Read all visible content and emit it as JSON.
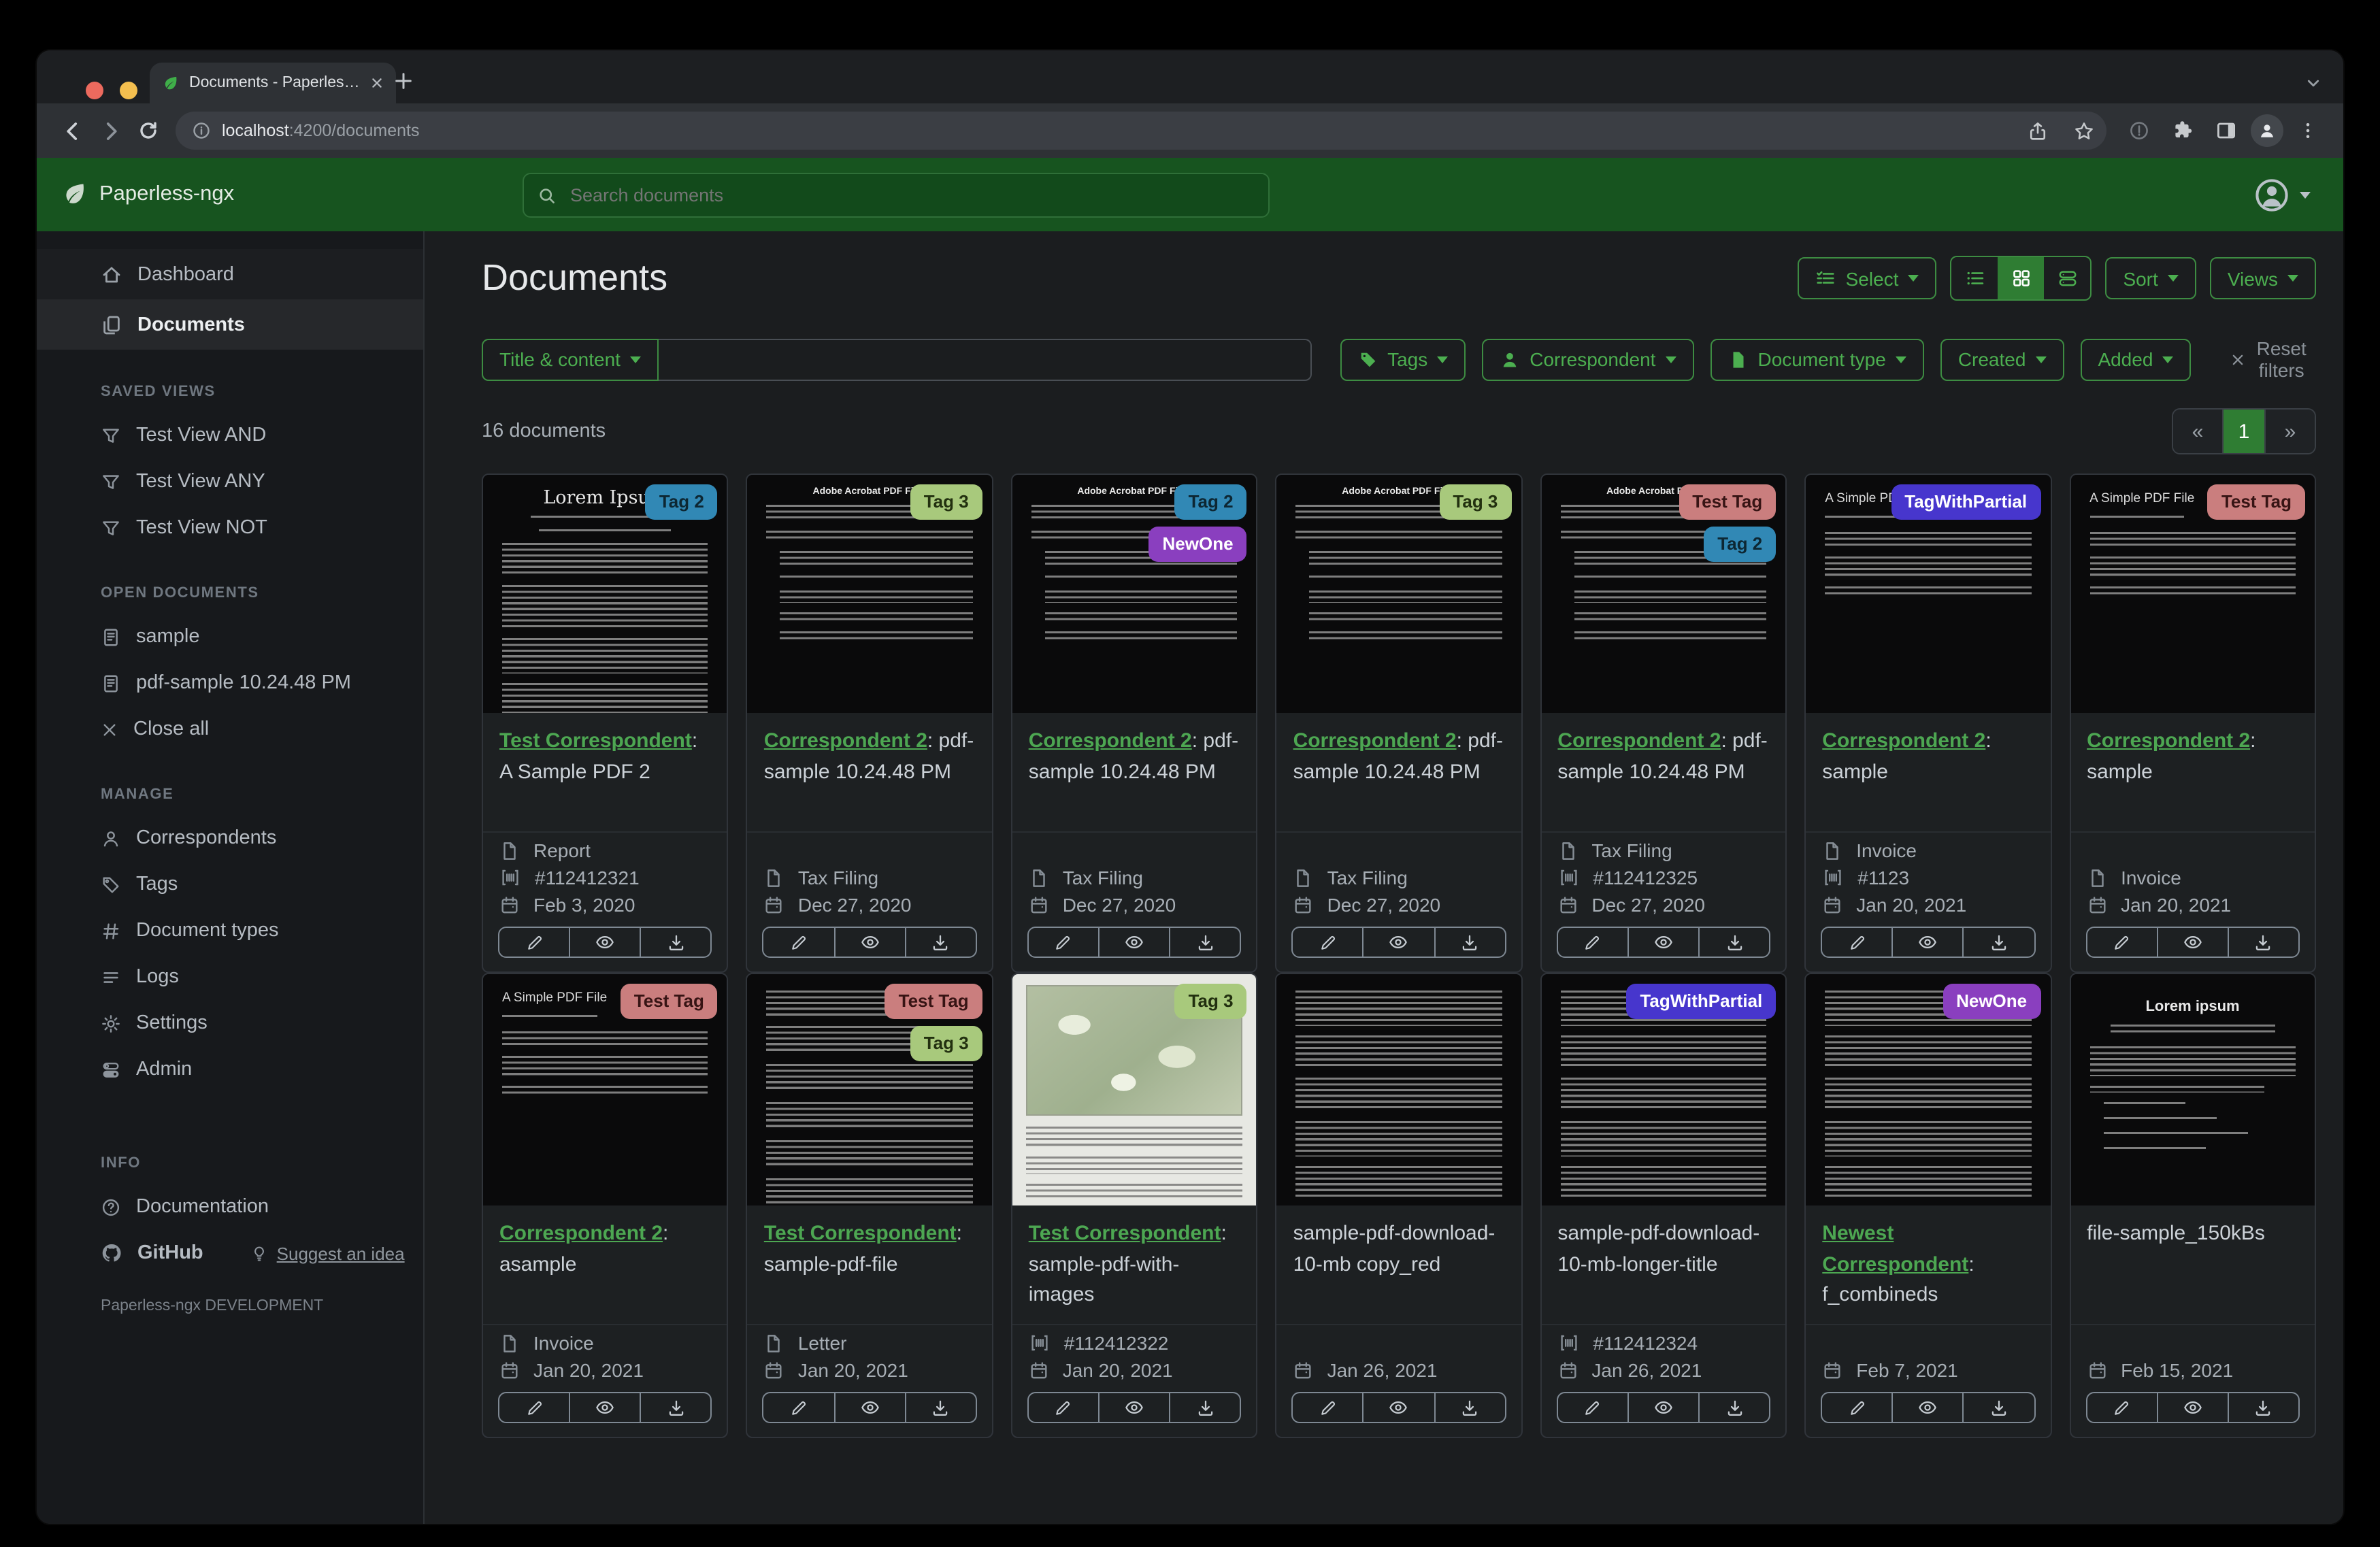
{
  "browser": {
    "tab_title": "Documents - Paperless-ngx",
    "url_host": "localhost",
    "url_rest": ":4200/documents"
  },
  "header": {
    "app_name": "Paperless-ngx",
    "search_placeholder": "Search documents"
  },
  "sidebar": {
    "nav_dashboard": "Dashboard",
    "nav_documents": "Documents",
    "saved_views_title": "SAVED VIEWS",
    "saved_views": [
      "Test View AND",
      "Test View ANY",
      "Test View NOT"
    ],
    "open_documents_title": "OPEN DOCUMENTS",
    "open_documents": [
      "sample",
      "pdf-sample 10.24.48 PM"
    ],
    "close_all": "Close all",
    "manage_title": "MANAGE",
    "manage": [
      "Correspondents",
      "Tags",
      "Document types",
      "Logs",
      "Settings",
      "Admin"
    ],
    "info_title": "INFO",
    "documentation": "Documentation",
    "github": "GitHub",
    "suggest": "Suggest an idea",
    "footer": "Paperless-ngx DEVELOPMENT"
  },
  "page": {
    "title": "Documents",
    "select_label": "Select",
    "sort_label": "Sort",
    "views_label": "Views",
    "count": "16 documents"
  },
  "filters": {
    "field": "Title & content",
    "tags": "Tags",
    "correspondent": "Correspondent",
    "document_type": "Document type",
    "created": "Created",
    "added": "Added",
    "reset": "Reset filters"
  },
  "pagination": {
    "prev": "«",
    "page": "1",
    "next": "»"
  },
  "accent_colors": {
    "header_green": "#17541f",
    "button_green": "#4caf50",
    "active_green": "#2f7d33",
    "link_green": "#4da752"
  },
  "tag_styles": {
    "Tag 2": {
      "bg": "#3188b5",
      "fg": "#0d2733"
    },
    "Tag 3": {
      "bg": "#a8c97c",
      "fg": "#22300f"
    },
    "NewOne": {
      "bg": "#8a3fbf",
      "fg": "#ffffff"
    },
    "Test Tag": {
      "bg": "#ca7e7e",
      "fg": "#371414"
    },
    "TagWithPartial": {
      "bg": "#4736cd",
      "fg": "#ffffff"
    }
  },
  "thumb_headings": {
    "lorem": "Lorem Ipsum",
    "acrobat": "Adobe Acrobat PDF Files",
    "simple": "A Simple PDF File",
    "loremcenter": "Lorem ipsum"
  },
  "cards": [
    {
      "row": 1,
      "tags": [
        "Tag 2"
      ],
      "link": "Test Correspondent",
      "rest": ": A Sample PDF 2",
      "type": "Report",
      "asn": "#112412321",
      "date": "Feb 3, 2020",
      "thumb": "lorem"
    },
    {
      "row": 1,
      "tags": [
        "Tag 3"
      ],
      "link": "Correspondent 2",
      "rest": ": pdf-sample 10.24.48 PM",
      "type": "Tax Filing",
      "asn": null,
      "date": "Dec 27, 2020",
      "thumb": "acrobat"
    },
    {
      "row": 1,
      "tags": [
        "Tag 2",
        "NewOne"
      ],
      "link": "Correspondent 2",
      "rest": ": pdf-sample 10.24.48 PM",
      "type": "Tax Filing",
      "asn": null,
      "date": "Dec 27, 2020",
      "thumb": "acrobat"
    },
    {
      "row": 1,
      "tags": [
        "Tag 3"
      ],
      "link": "Correspondent 2",
      "rest": ": pdf-sample 10.24.48 PM",
      "type": "Tax Filing",
      "asn": null,
      "date": "Dec 27, 2020",
      "thumb": "acrobat"
    },
    {
      "row": 1,
      "tags": [
        "Test Tag",
        "Tag 2"
      ],
      "link": "Correspondent 2",
      "rest": ": pdf-sample 10.24.48 PM",
      "type": "Tax Filing",
      "asn": "#112412325",
      "date": "Dec 27, 2020",
      "thumb": "acrobat"
    },
    {
      "row": 1,
      "tags": [
        "TagWithPartial"
      ],
      "link": "Correspondent 2",
      "rest": ": sample",
      "type": "Invoice",
      "asn": "#1123",
      "date": "Jan 20, 2021",
      "thumb": "simple"
    },
    {
      "row": 1,
      "tags": [
        "Test Tag"
      ],
      "link": "Correspondent 2",
      "rest": ": sample",
      "type": "Invoice",
      "asn": null,
      "date": "Jan 20, 2021",
      "thumb": "simple"
    },
    {
      "row": 2,
      "tags": [
        "Test Tag"
      ],
      "link": "Correspondent 2",
      "rest": ": asample",
      "type": "Invoice",
      "asn": null,
      "date": "Jan 20, 2021",
      "thumb": "simple"
    },
    {
      "row": 2,
      "tags": [
        "Test Tag",
        "Tag 3"
      ],
      "link": "Test Correspondent",
      "rest": ": sample-pdf-file",
      "type": "Letter",
      "asn": null,
      "date": "Jan 20, 2021",
      "thumb": "paragraphs"
    },
    {
      "row": 2,
      "tags": [
        "Tag 3"
      ],
      "link": "Test Correspondent",
      "rest": ": sample-pdf-with-images",
      "type": null,
      "asn": "#112412322",
      "date": "Jan 20, 2021",
      "thumb": "map"
    },
    {
      "row": 2,
      "tags": [],
      "plain": "sample-pdf-download-10-mb copy_red",
      "type": null,
      "asn": null,
      "date": "Jan 26, 2021",
      "thumb": "dense"
    },
    {
      "row": 2,
      "tags": [
        "TagWithPartial"
      ],
      "plain": "sample-pdf-download-10-mb-longer-title",
      "type": null,
      "asn": "#112412324",
      "date": "Jan 26, 2021",
      "thumb": "dense"
    },
    {
      "row": 2,
      "tags": [
        "NewOne"
      ],
      "link": "Newest Correspondent",
      "rest": ": f_combineds",
      "type": null,
      "asn": null,
      "date": "Feb 7, 2021",
      "thumb": "dense"
    },
    {
      "row": 2,
      "tags": [],
      "plain": "file-sample_150kBs",
      "type": null,
      "asn": null,
      "date": "Feb 15, 2021",
      "thumb": "loremcenter"
    }
  ]
}
